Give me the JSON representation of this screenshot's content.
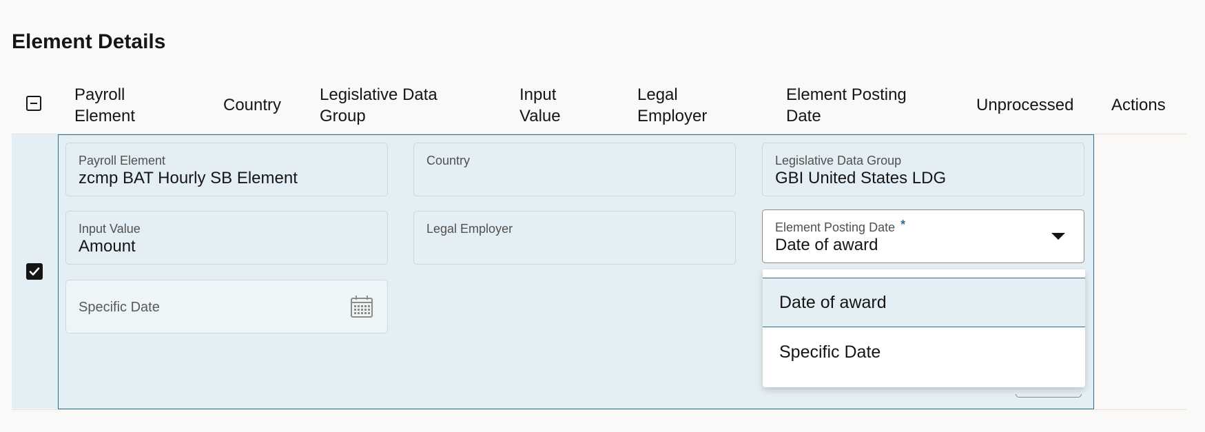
{
  "page": {
    "title": "Element Details"
  },
  "table": {
    "columns": [
      "Payroll\nElement",
      "Country",
      "Legislative Data\nGroup",
      "Input\nValue",
      "Legal\nEmployer",
      "Element Posting\nDate",
      "Unprocessed",
      "Actions"
    ],
    "columns_display": {
      "payroll_element_1": "Payroll",
      "payroll_element_2": "Element",
      "country": "Country",
      "ldg_1": "Legislative Data",
      "ldg_2": "Group",
      "input_value_1": "Input",
      "input_value_2": "Value",
      "legal_employer_1": "Legal",
      "legal_employer_2": "Employer",
      "posting_date_1": "Element Posting",
      "posting_date_2": "Date",
      "unprocessed": "Unprocessed",
      "actions": "Actions"
    },
    "select_all_state": "indeterminate",
    "row_selected": true
  },
  "details": {
    "payroll_element": {
      "label": "Payroll Element",
      "value": "zcmp BAT Hourly SB Element"
    },
    "country": {
      "label": "Country",
      "value": ""
    },
    "legislative_data_group": {
      "label": "Legislative Data Group",
      "value": "GBI United States LDG"
    },
    "input_value": {
      "label": "Input Value",
      "value": "Amount"
    },
    "legal_employer": {
      "label": "Legal Employer",
      "value": ""
    },
    "element_posting_date": {
      "label": "Element Posting Date",
      "required_marker": "*",
      "value": "Date of award"
    },
    "specific_date": {
      "label": "Specific Date",
      "value": ""
    }
  },
  "dropdown": {
    "options": [
      "Date of award",
      "Specific Date"
    ],
    "selected": "Date of award"
  },
  "icons": {
    "select_all": "minus-checkbox-icon",
    "row_check": "checkmark-checkbox-icon",
    "calendar": "calendar-icon",
    "caret": "caret-down-icon"
  },
  "colors": {
    "panel_background": "#e4eff5",
    "panel_border": "#2c6f8a",
    "required_star": "#2d6f9c",
    "page_background": "#faf9f8"
  }
}
